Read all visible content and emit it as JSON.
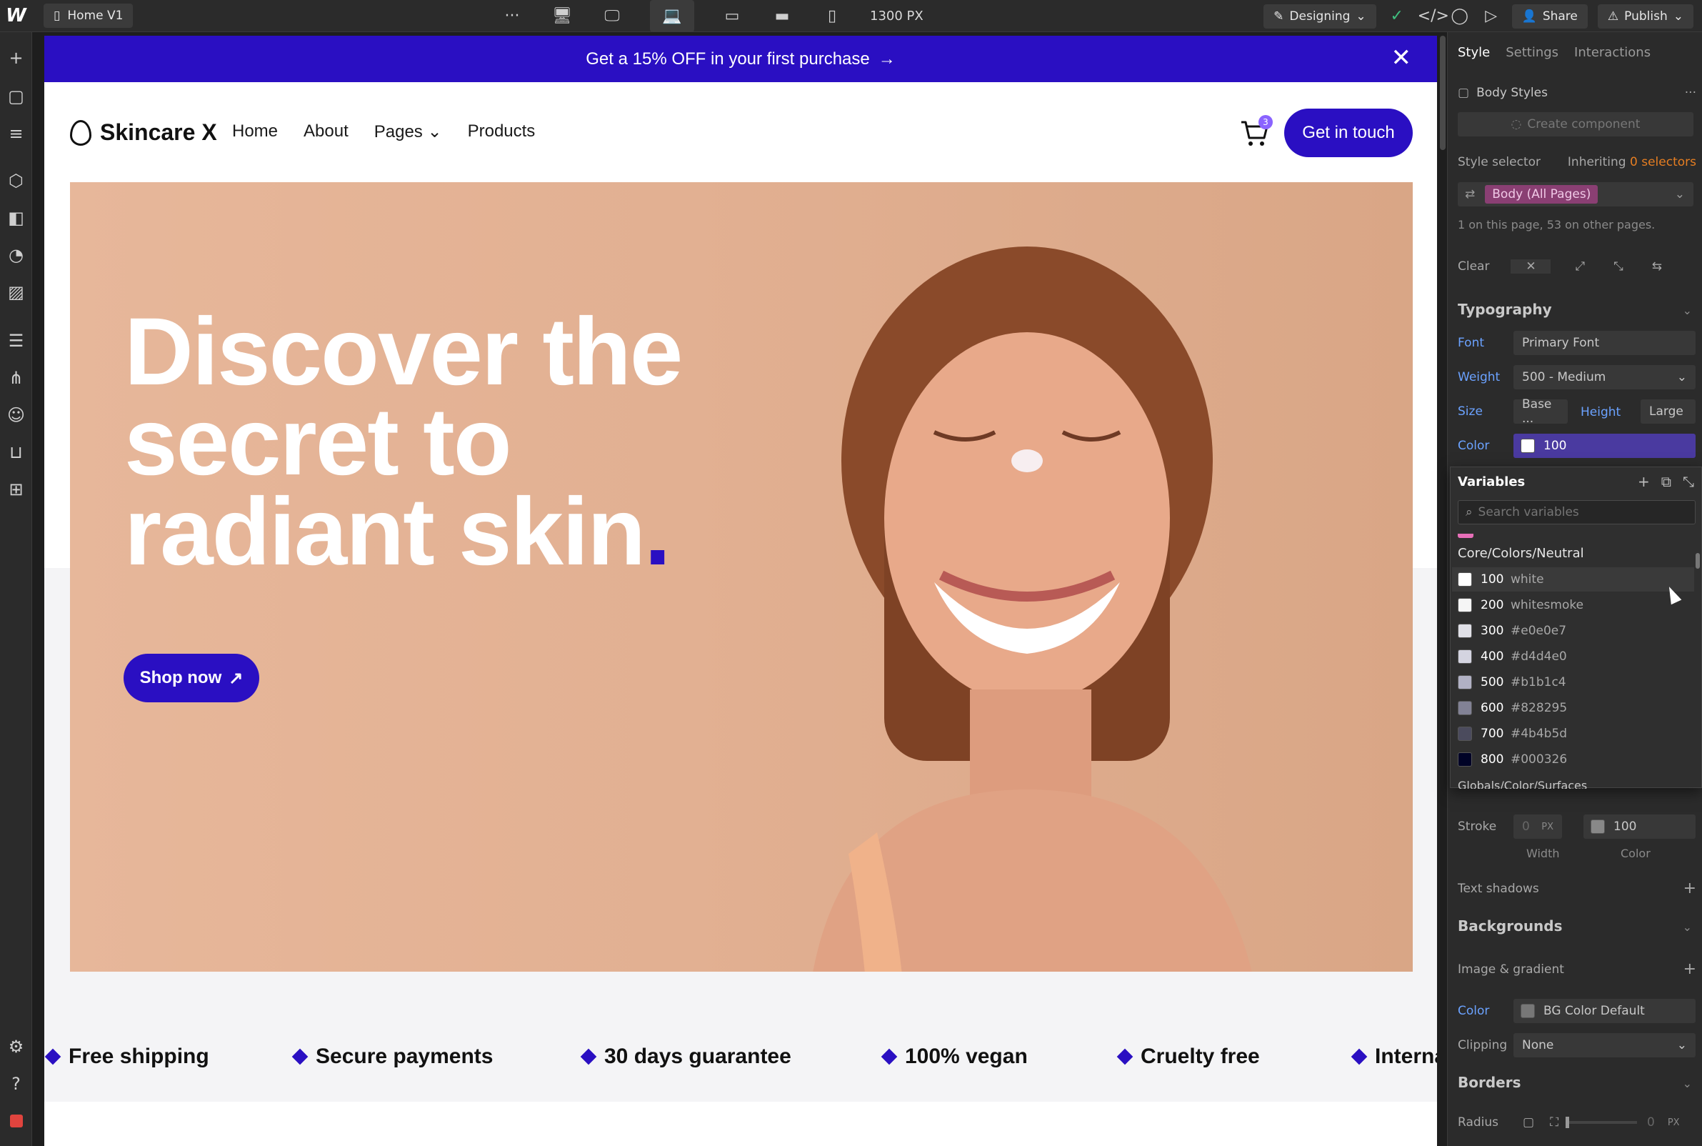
{
  "topbar": {
    "page_name": "Home V1",
    "more_label": "···",
    "canvas_width": "1300 PX",
    "mode": "Designing",
    "share_label": "Share",
    "publish_label": "Publish"
  },
  "site": {
    "promo_text": "Get a 15% OFF in your first purchase",
    "brand": "Skincare X",
    "nav": [
      "Home",
      "About",
      "Pages",
      "Products"
    ],
    "cart_count": "3",
    "cta": "Get in touch",
    "hero_line1": "Discover the",
    "hero_line2": "secret to",
    "hero_line3": "radiant skin",
    "hero_dot": ".",
    "shop_label": "Shop now",
    "features": [
      "Free shipping",
      "Secure payments",
      "30 days guarantee",
      "100% vegan",
      "Cruelty free",
      "Interna"
    ]
  },
  "panel": {
    "tabs": [
      "Style",
      "Settings",
      "Interactions"
    ],
    "body_styles": "Body Styles",
    "create_component": "Create component",
    "style_selector": "Style selector",
    "inheriting": "Inheriting",
    "inheriting_count": "0 selectors",
    "selector_chip": "Body (All Pages)",
    "selector_info": "1 on this page, 53 on other pages.",
    "clear": "Clear",
    "typography": "Typography",
    "font_label": "Font",
    "font_value": "Primary Font",
    "weight_label": "Weight",
    "weight_value": "500 - Medium",
    "size_label": "Size",
    "size_value": "Base ...",
    "height_label": "Height",
    "height_value": "Large",
    "color_label": "Color",
    "color_value": "100",
    "stroke_label": "Stroke",
    "stroke_width": "0",
    "stroke_unit": "PX",
    "stroke_color": "100",
    "width_label": "Width",
    "color_sub_label": "Color",
    "text_shadows": "Text shadows",
    "backgrounds": "Backgrounds",
    "image_gradient": "Image & gradient",
    "bg_color_label": "Color",
    "bg_color_value": "BG Color Default",
    "clipping_label": "Clipping",
    "clipping_value": "None",
    "borders": "Borders",
    "radius_label": "Radius",
    "radius_value": "0",
    "radius_unit": "PX"
  },
  "variables": {
    "title": "Variables",
    "search_placeholder": "Search variables",
    "group": "Core/Colors/Neutral",
    "next_group": "Globals/Color/Surfaces",
    "items": [
      {
        "name": "100",
        "value": "white",
        "color": "#ffffff"
      },
      {
        "name": "200",
        "value": "whitesmoke",
        "color": "#f5f5f5"
      },
      {
        "name": "300",
        "value": "#e0e0e7",
        "color": "#e0e0e7"
      },
      {
        "name": "400",
        "value": "#d4d4e0",
        "color": "#d4d4e0"
      },
      {
        "name": "500",
        "value": "#b1b1c4",
        "color": "#b1b1c4"
      },
      {
        "name": "600",
        "value": "#828295",
        "color": "#828295"
      },
      {
        "name": "700",
        "value": "#4b4b5d",
        "color": "#4b4b5d"
      },
      {
        "name": "800",
        "value": "#000326",
        "color": "#000326"
      }
    ]
  },
  "colors": {
    "brand": "#2a0fc2",
    "selector_chip": "#8a3f73",
    "accent_link": "#6ba2ff",
    "inheriting_count": "#e67e22"
  }
}
